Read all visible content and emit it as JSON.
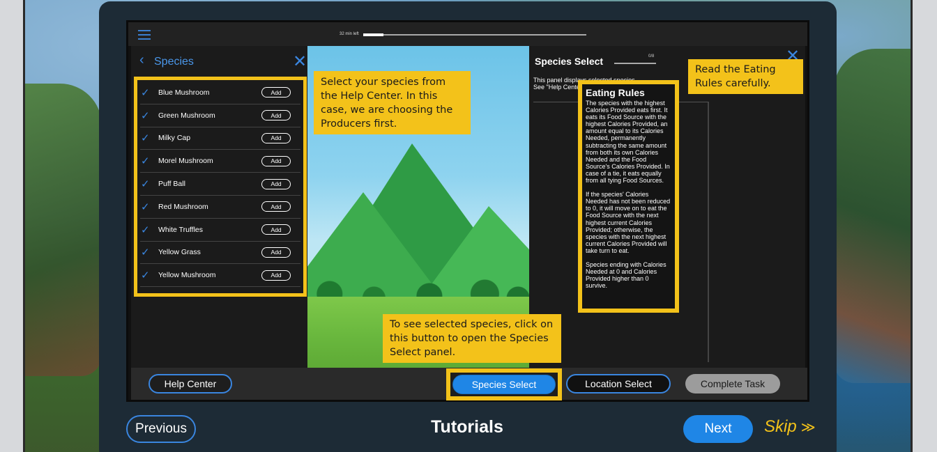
{
  "topbar": {
    "timer_text": "32 min left",
    "timer_progress": 0.09
  },
  "species_panel": {
    "title": "Species",
    "items": [
      {
        "name": "Blue Mushroom",
        "action": "Add"
      },
      {
        "name": "Green Mushroom",
        "action": "Add"
      },
      {
        "name": "Milky Cap",
        "action": "Add"
      },
      {
        "name": "Morel Mushroom",
        "action": "Add"
      },
      {
        "name": "Puff Ball",
        "action": "Add"
      },
      {
        "name": "Red Mushroom",
        "action": "Add"
      },
      {
        "name": "White Truffles",
        "action": "Add"
      },
      {
        "name": "Yellow Grass",
        "action": "Add"
      },
      {
        "name": "Yellow Mushroom",
        "action": "Add"
      }
    ]
  },
  "select_panel": {
    "title": "Species Select",
    "count": "0/8",
    "desc_line1": "This panel displays selected species.",
    "desc_line2": "See \"Help Center\" for all 39 available species"
  },
  "rules": {
    "title": "Eating Rules",
    "para1": "The species with the highest Calories Provided eats first. It eats its Food Source with the highest Calories Provided, an amount equal to its Calories Needed, permanently subtracting the same amount from both its own Calories Needed and the Food Source's Calories Provided. In case of a tie, it eats equally from all tying Food Sources.",
    "para2": "If the species' Calories Needed has not been reduced to 0, it will move on to eat the Food Source with the next highest current Calories Provided; otherwise, the species with the next highest current Calories Provided will take turn to eat.",
    "para3": "Species ending with Calories Needed at 0 and Calories Provided higher than 0 survive."
  },
  "callouts": {
    "select_species": "Select your species from the Help Center. In this case, we are choosing the Producers first.",
    "read_rules": "Read the Eating Rules carefully.",
    "open_panel": "To see selected species, click on this button to open the Species Select panel."
  },
  "bottom_bar": {
    "help_center": "Help Center",
    "species_select": "Species Select",
    "location_select": "Location Select",
    "complete_task": "Complete Task"
  },
  "footer": {
    "previous": "Previous",
    "title": "Tutorials",
    "next": "Next",
    "skip": "Skip"
  },
  "icons": {
    "menu": "menu-icon",
    "back": "chevron-left-icon",
    "close": "close-icon",
    "check": "check-icon",
    "skip": "double-chevron-right-icon"
  },
  "colors": {
    "accent": "#1f86e6",
    "highlight": "#f3c21a",
    "panel": "#1d2b36"
  }
}
